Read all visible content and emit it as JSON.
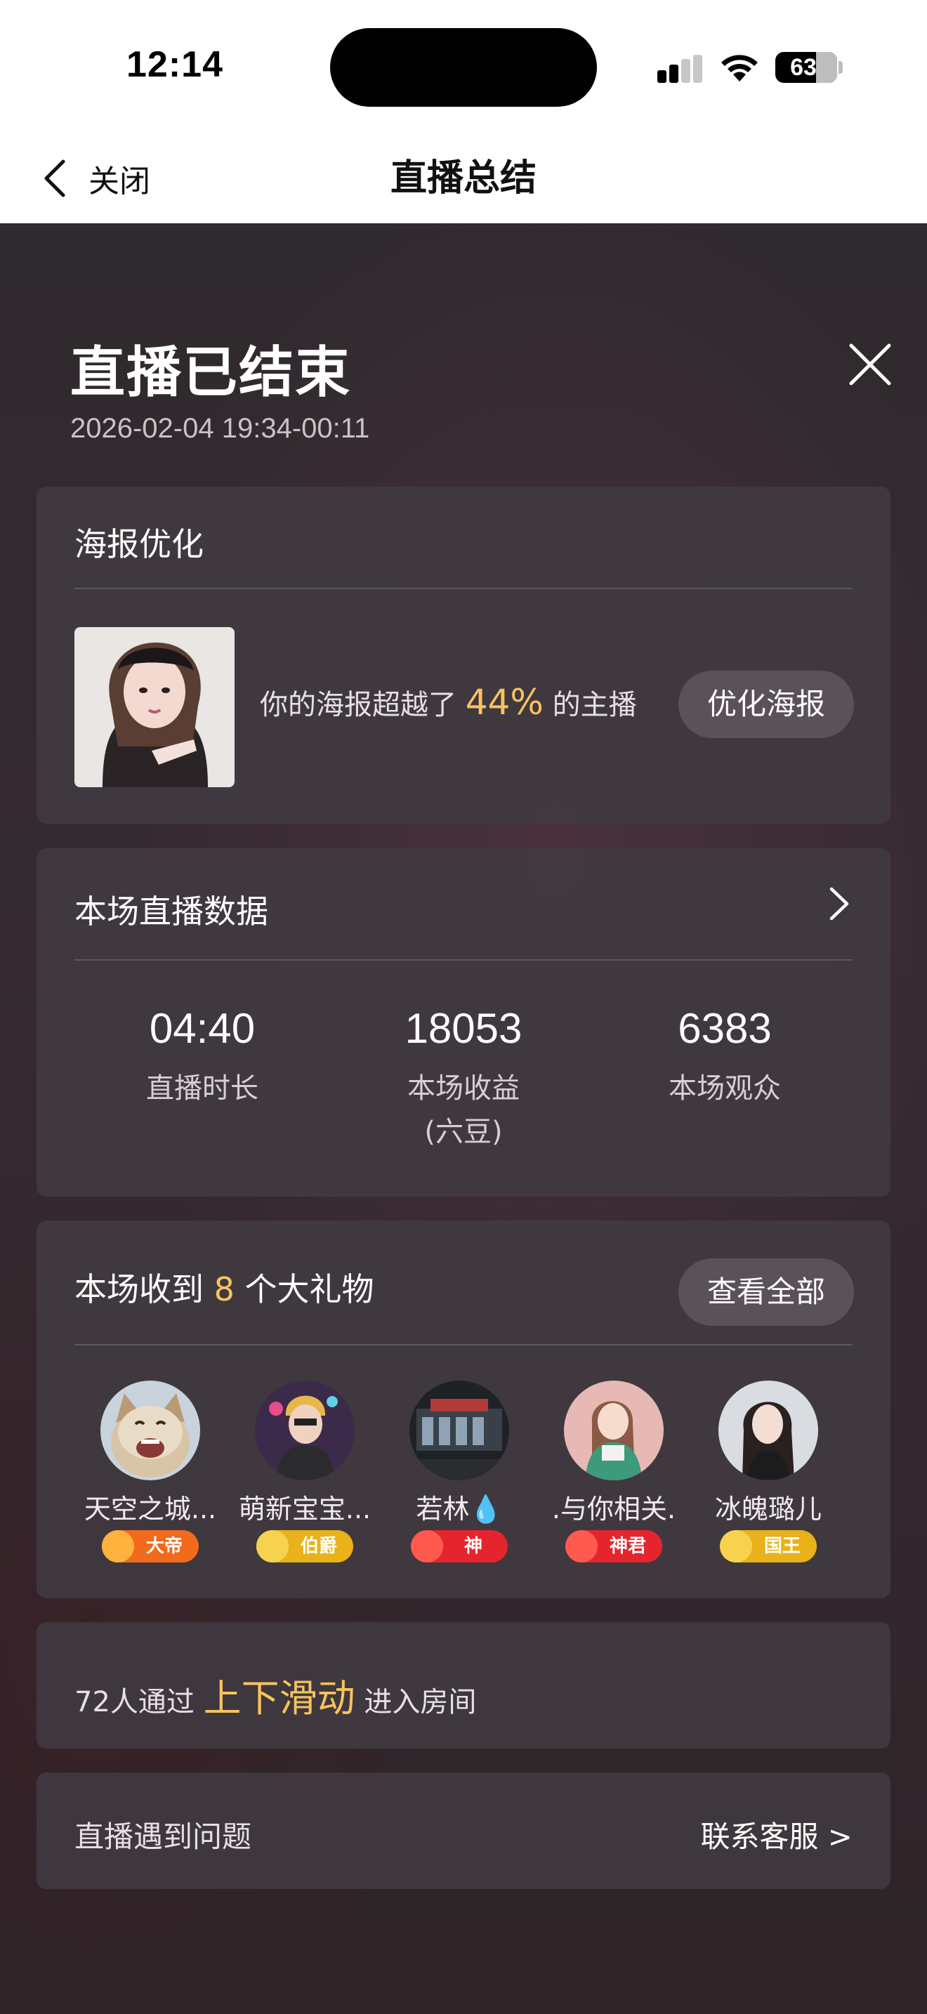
{
  "status_bar": {
    "time": "12:14",
    "battery": "63",
    "icons": [
      "signal-icon",
      "wifi-icon",
      "battery-icon"
    ]
  },
  "nav": {
    "back_label": "关闭",
    "title": "直播总结",
    "back_icon": "chevron-left-icon"
  },
  "header": {
    "title": "直播已结束",
    "time_range": "2026-02-04 19:34-00:11",
    "close_icon": "close-icon"
  },
  "poster": {
    "title": "海报优化",
    "text_prefix": "你的海报超越了",
    "percent": "44%",
    "text_suffix": "的主播",
    "button": "优化海报"
  },
  "stats": {
    "title": "本场直播数据",
    "items": [
      {
        "value": "04:40",
        "label": "直播时长",
        "sublabel": ""
      },
      {
        "value": "18053",
        "label": "本场收益",
        "sublabel": "(六豆)"
      },
      {
        "value": "6383",
        "label": "本场观众",
        "sublabel": ""
      }
    ]
  },
  "gifts": {
    "title_prefix": "本场收到",
    "count": "8",
    "title_suffix": "个大礼物",
    "button": "查看全部",
    "gifters": [
      {
        "name": "天空之城...",
        "badge": "大帝",
        "badge_color": "#f26a1b"
      },
      {
        "name": "萌新宝宝...",
        "badge": "伯爵",
        "badge_color": "#e9b21a"
      },
      {
        "name": "若林💧",
        "badge": "神",
        "badge_color": "#e5252d"
      },
      {
        "name": ".与你相关.",
        "badge": "神君",
        "badge_color": "#e5252d"
      },
      {
        "name": "冰魄璐儿",
        "badge": "国王",
        "badge_color": "#e9b21a"
      }
    ]
  },
  "swipe": {
    "prefix": "72人通过",
    "highlight": "上下滑动",
    "suffix": "进入房间"
  },
  "support": {
    "label": "直播遇到问题",
    "link": "联系客服 >"
  },
  "colors": {
    "accent": "#f7c35e",
    "card_bg": "#403a40",
    "pill_bg": "#5b5159"
  }
}
